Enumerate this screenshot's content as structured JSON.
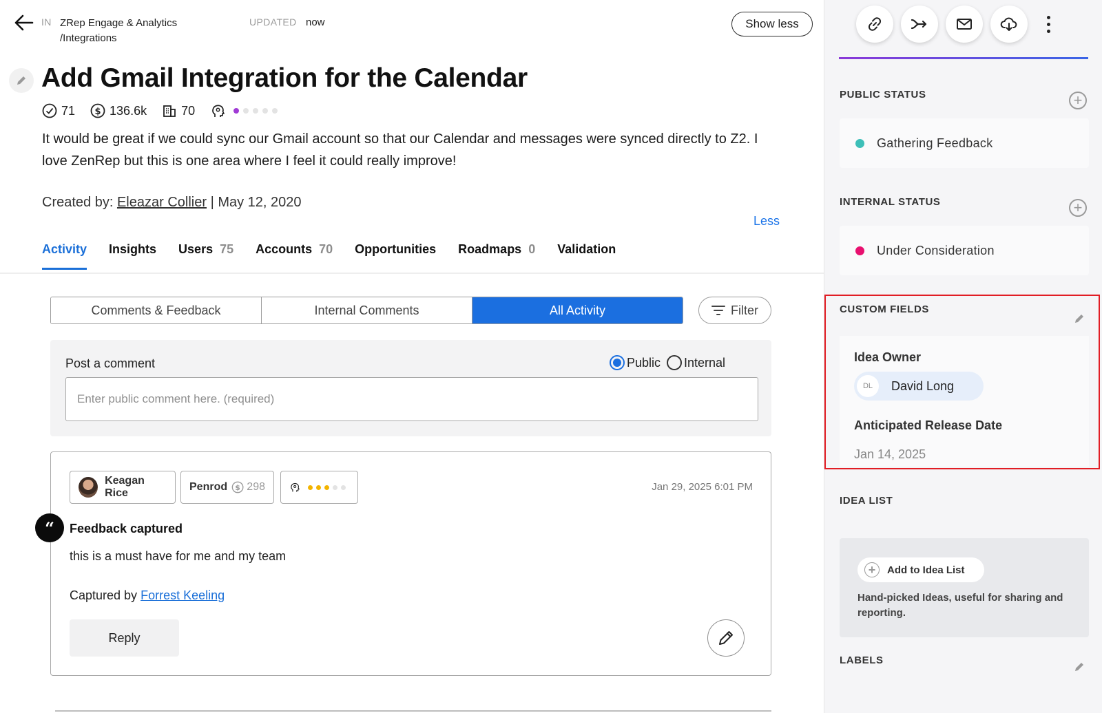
{
  "header": {
    "in_label": "IN",
    "breadcrumb_line1": "ZRep Engage & Analytics",
    "breadcrumb_line2": "/Integrations",
    "updated_label": "UPDATED",
    "updated_value": "now",
    "show_less": "Show less"
  },
  "idea": {
    "title": "Add Gmail Integration for the Calendar",
    "votes": "71",
    "revenue": "136.6k",
    "accounts": "70",
    "description": "It would be great if we could sync our Gmail account so that our Calendar and messages were synced directly to Z2. I love ZenRep but this is one area where I feel it could really improve!",
    "created_prefix": "Created by:",
    "created_by": "Eleazar Collier",
    "created_date": "| May 12, 2020",
    "less_link": "Less"
  },
  "tabs": [
    {
      "label": "Activity",
      "count": ""
    },
    {
      "label": "Insights",
      "count": ""
    },
    {
      "label": "Users",
      "count": "75"
    },
    {
      "label": "Accounts",
      "count": "70"
    },
    {
      "label": "Opportunities",
      "count": ""
    },
    {
      "label": "Roadmaps",
      "count": "0"
    },
    {
      "label": "Validation",
      "count": ""
    }
  ],
  "segments": [
    "Comments & Feedback",
    "Internal Comments",
    "All Activity"
  ],
  "filter_label": "Filter",
  "post": {
    "label": "Post a comment",
    "public": "Public",
    "internal": "Internal",
    "placeholder": "Enter public comment here. (required)"
  },
  "feedback": {
    "user": "Keagan Rice",
    "account": "Penrod",
    "account_value": "298",
    "date": "Jan 29, 2025 6:01 PM",
    "quote_glyph": "“",
    "title": "Feedback captured",
    "text": "this is a must have for me and my team",
    "captured_prefix": "Captured by",
    "captured_by": "Forrest Keeling",
    "reply": "Reply"
  },
  "sidebar": {
    "public_status_title": "PUBLIC STATUS",
    "public_status": "Gathering Feedback",
    "public_status_color": "#3dbfb8",
    "internal_status_title": "INTERNAL STATUS",
    "internal_status": "Under Consideration",
    "internal_status_color": "#e8106f",
    "custom_fields_title": "CUSTOM FIELDS",
    "idea_owner_label": "Idea Owner",
    "idea_owner_initials": "DL",
    "idea_owner": "David Long",
    "release_label": "Anticipated Release Date",
    "release_date": "Jan 14, 2025",
    "idea_list_title": "IDEA LIST",
    "add_idea_list": "Add to Idea List",
    "idea_list_help": "Hand-picked Ideas, useful for sharing and reporting.",
    "labels_title": "LABELS"
  }
}
